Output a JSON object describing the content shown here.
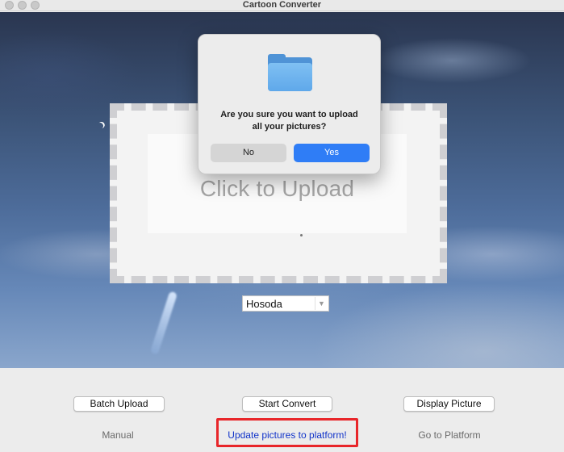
{
  "window": {
    "title": "Cartoon Converter"
  },
  "upload": {
    "label": "Click to Upload"
  },
  "style_select": {
    "value": "Hosoda"
  },
  "dialog": {
    "message_line1": "Are you sure you want to upload",
    "message_line2": "all your pictures?",
    "no_label": "No",
    "yes_label": "Yes"
  },
  "buttons": {
    "batch_upload": "Batch Upload",
    "start_convert": "Start Convert",
    "display_picture": "Display Picture"
  },
  "links": {
    "manual": "Manual",
    "update": "Update pictures to platform!",
    "platform": "Go to Platform"
  },
  "colors": {
    "accent": "#2f7df6",
    "highlight_border": "#e8262a",
    "link_blue": "#1033c9"
  },
  "icons": {
    "dialog_icon": "folder-icon",
    "select_arrow": "chevron-down-icon"
  }
}
